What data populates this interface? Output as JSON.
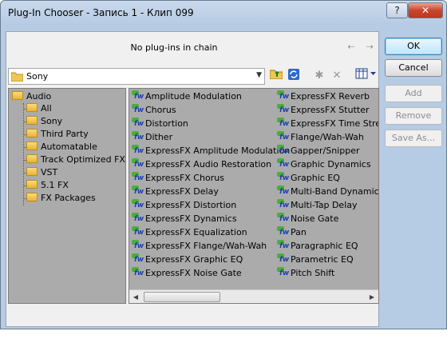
{
  "window": {
    "title": "Plug-In Chooser - Запись 1 - Клип 099",
    "help_label": "?",
    "close_label": "✕"
  },
  "chain": {
    "status": "No plug-ins in chain"
  },
  "buttons": {
    "ok": "OK",
    "cancel": "Cancel",
    "add": "Add",
    "remove": "Remove",
    "save_as": "Save As..."
  },
  "folder_combo": {
    "value": "Sony"
  },
  "tree": {
    "root": "Audio",
    "children": [
      "All",
      "Sony",
      "Third Party",
      "Automatable",
      "Track Optimized FX",
      "VST",
      "5.1 FX",
      "FX Packages"
    ]
  },
  "plugins": {
    "col1": [
      "Amplitude Modulation",
      "Chorus",
      "Distortion",
      "Dither",
      "ExpressFX Amplitude Modulation",
      "ExpressFX Audio Restoration",
      "ExpressFX Chorus",
      "ExpressFX Delay",
      "ExpressFX Distortion",
      "ExpressFX Dynamics",
      "ExpressFX Equalization",
      "ExpressFX Flange/Wah-Wah",
      "ExpressFX Graphic EQ",
      "ExpressFX Noise Gate"
    ],
    "col2": [
      "ExpressFX Reverb",
      "ExpressFX Stutter",
      "ExpressFX Time Stretch",
      "Flange/Wah-Wah",
      "Gapper/Snipper",
      "Graphic Dynamics",
      "Graphic EQ",
      "Multi-Band Dynamics",
      "Multi-Tap Delay",
      "Noise Gate",
      "Pan",
      "Paragraphic EQ",
      "Parametric EQ",
      "Pitch Shift"
    ]
  }
}
